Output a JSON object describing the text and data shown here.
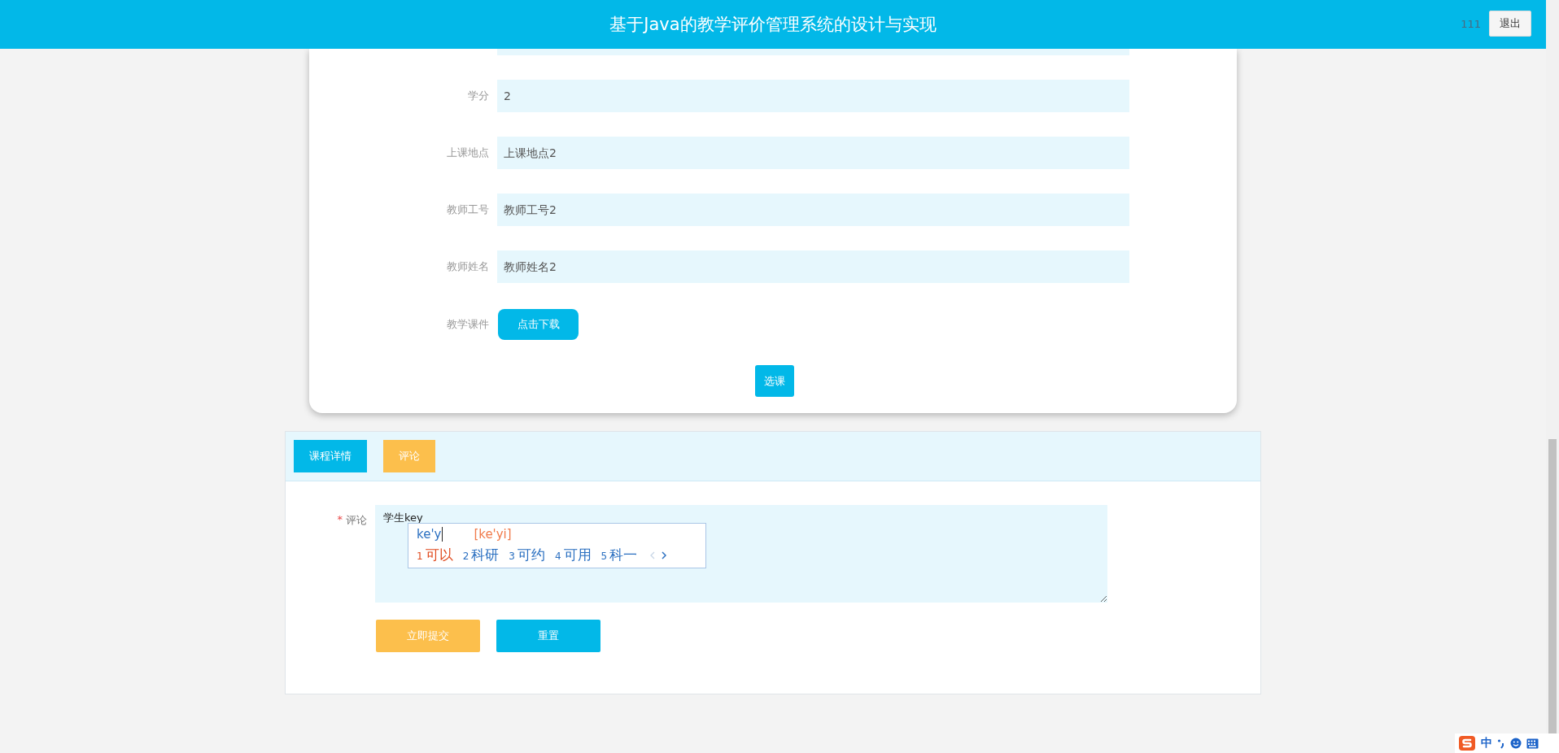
{
  "header": {
    "title": "基于Java的教学评价管理系统的设计与实现",
    "user": "111",
    "logout": "退出"
  },
  "course_form": {
    "fields": [
      {
        "label": "学分",
        "value": "2"
      },
      {
        "label": "上课地点",
        "value": "上课地点2"
      },
      {
        "label": "教师工号",
        "value": "教师工号2"
      },
      {
        "label": "教师姓名",
        "value": "教师姓名2"
      }
    ],
    "courseware": {
      "label": "教学课件",
      "button": "点击下载"
    },
    "select_button": "选课"
  },
  "tabs": [
    {
      "label": "课程详情",
      "selected": false
    },
    {
      "label": "评论",
      "selected": true
    }
  ],
  "comment_form": {
    "label": "评论",
    "required": true,
    "required_mark": "*",
    "value": "学生key",
    "submit": "立即提交",
    "reset": "重置"
  },
  "ime_popup": {
    "composition": "ke'y",
    "pinyin": "[ke'yi]",
    "candidates": [
      {
        "index": "1",
        "text": "可以",
        "selected": true
      },
      {
        "index": "2",
        "text": "科研",
        "selected": false
      },
      {
        "index": "3",
        "text": "可约",
        "selected": false
      },
      {
        "index": "4",
        "text": "可用",
        "selected": false
      },
      {
        "index": "5",
        "text": "科一",
        "selected": false
      }
    ]
  },
  "ime_toolbar": {
    "mode": "中"
  }
}
